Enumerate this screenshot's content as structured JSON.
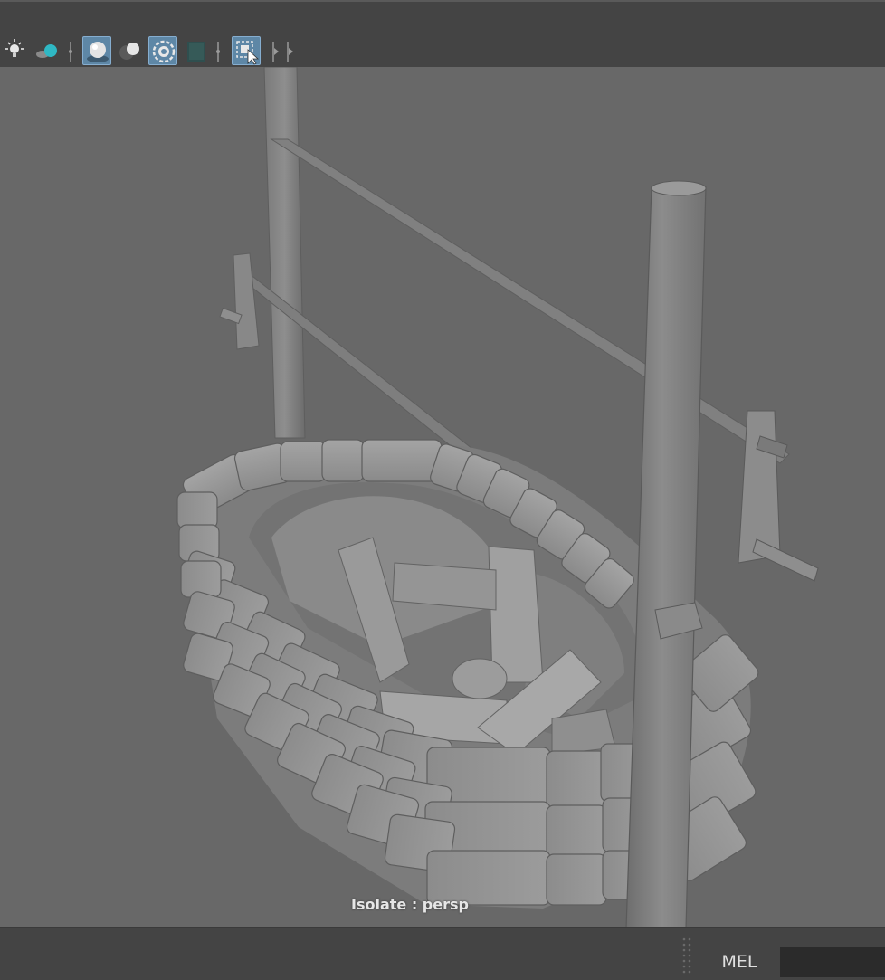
{
  "toolbar": {
    "icons": [
      "light-bulb-icon",
      "lights-shadow-icon",
      "separator-icon",
      "ambient-occlusion-icon",
      "motion-blur-icon",
      "anti-aliasing-icon",
      "depth-of-field-icon",
      "separator-icon",
      "isolate-select-icon",
      "expand-toolbar-icon"
    ],
    "active_color": "#5e87a6"
  },
  "viewport": {
    "camera": "persp",
    "hud_label": "Isolate : persp",
    "background": "#686868"
  },
  "command_line": {
    "language_label": "MEL",
    "input_value": ""
  }
}
